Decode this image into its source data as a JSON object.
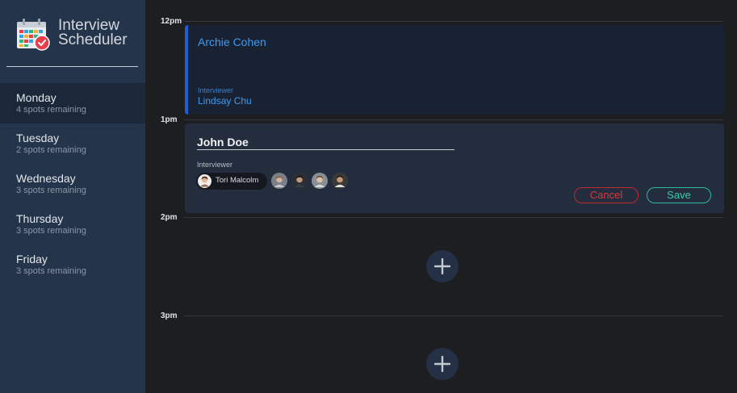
{
  "app": {
    "title": "Interview Scheduler"
  },
  "sidebar": {
    "days": [
      {
        "name": "Monday",
        "spots": "4 spots remaining",
        "active": true
      },
      {
        "name": "Tuesday",
        "spots": "2 spots remaining",
        "active": false
      },
      {
        "name": "Wednesday",
        "spots": "3 spots remaining",
        "active": false
      },
      {
        "name": "Thursday",
        "spots": "3 spots remaining",
        "active": false
      },
      {
        "name": "Friday",
        "spots": "3 spots remaining",
        "active": false
      }
    ]
  },
  "schedule": {
    "times": [
      "12pm",
      "1pm",
      "2pm",
      "3pm"
    ],
    "booked": {
      "student": "Archie Cohen",
      "interviewer_label": "Interviewer",
      "interviewer": "Lindsay Chu"
    },
    "edit": {
      "student_value": "John Doe",
      "interviewer_label": "Interviewer",
      "selected_interviewer": "Tori Malcolm",
      "other_interviewers": [
        "avatar-1",
        "avatar-2",
        "avatar-3",
        "avatar-4"
      ],
      "cancel_label": "Cancel",
      "save_label": "Save"
    },
    "add_icon": "plus-icon"
  },
  "colors": {
    "sidebar": "#24344a",
    "active_day": "#1b2839",
    "background": "#1d1e20",
    "booked_accent": "#1e5fd6",
    "booked_text": "#3f9aef",
    "cancel": "#c22a2f",
    "save": "#2fb89a"
  }
}
